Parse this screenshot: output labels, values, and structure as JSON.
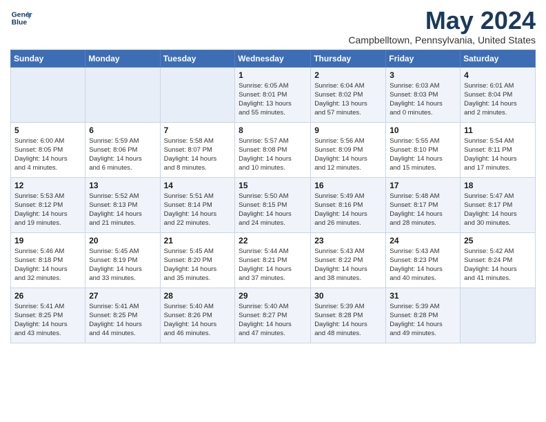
{
  "logo": {
    "line1": "General",
    "line2": "Blue"
  },
  "title": "May 2024",
  "location": "Campbelltown, Pennsylvania, United States",
  "days_of_week": [
    "Sunday",
    "Monday",
    "Tuesday",
    "Wednesday",
    "Thursday",
    "Friday",
    "Saturday"
  ],
  "weeks": [
    [
      {
        "day": "",
        "info": ""
      },
      {
        "day": "",
        "info": ""
      },
      {
        "day": "",
        "info": ""
      },
      {
        "day": "1",
        "info": "Sunrise: 6:05 AM\nSunset: 8:01 PM\nDaylight: 13 hours\nand 55 minutes."
      },
      {
        "day": "2",
        "info": "Sunrise: 6:04 AM\nSunset: 8:02 PM\nDaylight: 13 hours\nand 57 minutes."
      },
      {
        "day": "3",
        "info": "Sunrise: 6:03 AM\nSunset: 8:03 PM\nDaylight: 14 hours\nand 0 minutes."
      },
      {
        "day": "4",
        "info": "Sunrise: 6:01 AM\nSunset: 8:04 PM\nDaylight: 14 hours\nand 2 minutes."
      }
    ],
    [
      {
        "day": "5",
        "info": "Sunrise: 6:00 AM\nSunset: 8:05 PM\nDaylight: 14 hours\nand 4 minutes."
      },
      {
        "day": "6",
        "info": "Sunrise: 5:59 AM\nSunset: 8:06 PM\nDaylight: 14 hours\nand 6 minutes."
      },
      {
        "day": "7",
        "info": "Sunrise: 5:58 AM\nSunset: 8:07 PM\nDaylight: 14 hours\nand 8 minutes."
      },
      {
        "day": "8",
        "info": "Sunrise: 5:57 AM\nSunset: 8:08 PM\nDaylight: 14 hours\nand 10 minutes."
      },
      {
        "day": "9",
        "info": "Sunrise: 5:56 AM\nSunset: 8:09 PM\nDaylight: 14 hours\nand 12 minutes."
      },
      {
        "day": "10",
        "info": "Sunrise: 5:55 AM\nSunset: 8:10 PM\nDaylight: 14 hours\nand 15 minutes."
      },
      {
        "day": "11",
        "info": "Sunrise: 5:54 AM\nSunset: 8:11 PM\nDaylight: 14 hours\nand 17 minutes."
      }
    ],
    [
      {
        "day": "12",
        "info": "Sunrise: 5:53 AM\nSunset: 8:12 PM\nDaylight: 14 hours\nand 19 minutes."
      },
      {
        "day": "13",
        "info": "Sunrise: 5:52 AM\nSunset: 8:13 PM\nDaylight: 14 hours\nand 21 minutes."
      },
      {
        "day": "14",
        "info": "Sunrise: 5:51 AM\nSunset: 8:14 PM\nDaylight: 14 hours\nand 22 minutes."
      },
      {
        "day": "15",
        "info": "Sunrise: 5:50 AM\nSunset: 8:15 PM\nDaylight: 14 hours\nand 24 minutes."
      },
      {
        "day": "16",
        "info": "Sunrise: 5:49 AM\nSunset: 8:16 PM\nDaylight: 14 hours\nand 26 minutes."
      },
      {
        "day": "17",
        "info": "Sunrise: 5:48 AM\nSunset: 8:17 PM\nDaylight: 14 hours\nand 28 minutes."
      },
      {
        "day": "18",
        "info": "Sunrise: 5:47 AM\nSunset: 8:17 PM\nDaylight: 14 hours\nand 30 minutes."
      }
    ],
    [
      {
        "day": "19",
        "info": "Sunrise: 5:46 AM\nSunset: 8:18 PM\nDaylight: 14 hours\nand 32 minutes."
      },
      {
        "day": "20",
        "info": "Sunrise: 5:45 AM\nSunset: 8:19 PM\nDaylight: 14 hours\nand 33 minutes."
      },
      {
        "day": "21",
        "info": "Sunrise: 5:45 AM\nSunset: 8:20 PM\nDaylight: 14 hours\nand 35 minutes."
      },
      {
        "day": "22",
        "info": "Sunrise: 5:44 AM\nSunset: 8:21 PM\nDaylight: 14 hours\nand 37 minutes."
      },
      {
        "day": "23",
        "info": "Sunrise: 5:43 AM\nSunset: 8:22 PM\nDaylight: 14 hours\nand 38 minutes."
      },
      {
        "day": "24",
        "info": "Sunrise: 5:43 AM\nSunset: 8:23 PM\nDaylight: 14 hours\nand 40 minutes."
      },
      {
        "day": "25",
        "info": "Sunrise: 5:42 AM\nSunset: 8:24 PM\nDaylight: 14 hours\nand 41 minutes."
      }
    ],
    [
      {
        "day": "26",
        "info": "Sunrise: 5:41 AM\nSunset: 8:25 PM\nDaylight: 14 hours\nand 43 minutes."
      },
      {
        "day": "27",
        "info": "Sunrise: 5:41 AM\nSunset: 8:25 PM\nDaylight: 14 hours\nand 44 minutes."
      },
      {
        "day": "28",
        "info": "Sunrise: 5:40 AM\nSunset: 8:26 PM\nDaylight: 14 hours\nand 46 minutes."
      },
      {
        "day": "29",
        "info": "Sunrise: 5:40 AM\nSunset: 8:27 PM\nDaylight: 14 hours\nand 47 minutes."
      },
      {
        "day": "30",
        "info": "Sunrise: 5:39 AM\nSunset: 8:28 PM\nDaylight: 14 hours\nand 48 minutes."
      },
      {
        "day": "31",
        "info": "Sunrise: 5:39 AM\nSunset: 8:28 PM\nDaylight: 14 hours\nand 49 minutes."
      },
      {
        "day": "",
        "info": ""
      }
    ]
  ]
}
